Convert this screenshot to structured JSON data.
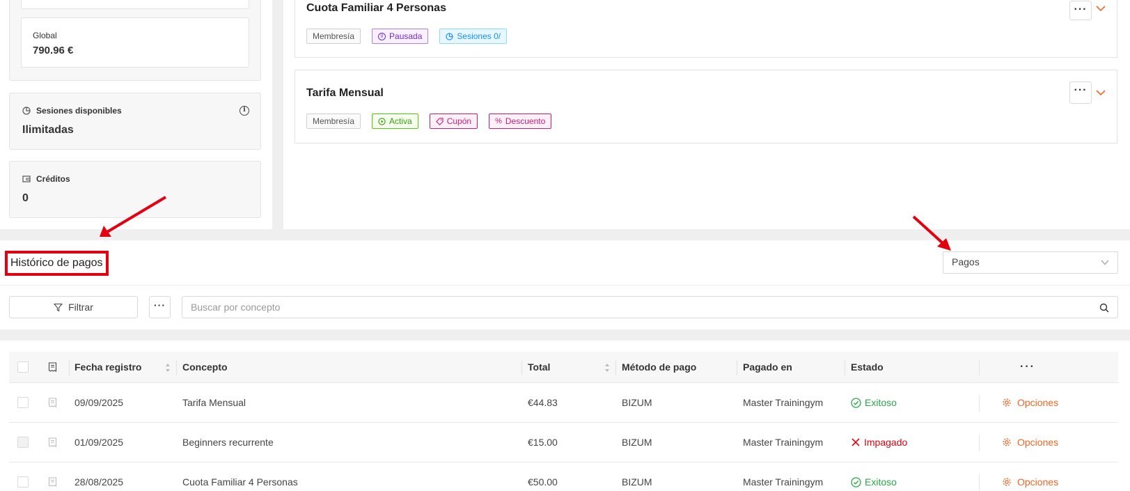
{
  "stats": {
    "global_label": "Global",
    "global_value": "790.96 €",
    "sessions_label": "Sesiones disponibles",
    "sessions_value": "Ilimitadas",
    "credits_label": "Créditos",
    "credits_value": "0"
  },
  "memberships": [
    {
      "title": "Cuota Familiar 4 Personas",
      "tags": [
        "Membresía",
        "Pausada",
        "Sesiones 0/"
      ]
    },
    {
      "title": "Tarifa Mensual",
      "tags": [
        "Membresía",
        "Activa",
        "Cupón",
        "Descuento"
      ]
    }
  ],
  "history": {
    "title": "Histórico de pagos",
    "select_value": "Pagos",
    "filter_label": "Filtrar",
    "search_placeholder": "Buscar por concepto"
  },
  "table": {
    "columns": [
      "Fecha registro",
      "Concepto",
      "Total",
      "Método de pago",
      "Pagado en",
      "Estado"
    ],
    "rows": [
      {
        "date": "09/09/2025",
        "concept": "Tarifa Mensual",
        "total": "€44.83",
        "method": "BIZUM",
        "paid_at": "Master Trainingym",
        "status": "Exitoso",
        "action": "Opciones"
      },
      {
        "date": "01/09/2025",
        "concept": "Beginners recurrente",
        "total": "€15.00",
        "method": "BIZUM",
        "paid_at": "Master Trainingym",
        "status": "Impagado",
        "action": "Opciones"
      },
      {
        "date": "28/08/2025",
        "concept": "Cuota Familiar 4 Personas",
        "total": "€50.00",
        "method": "BIZUM",
        "paid_at": "Master Trainingym",
        "status": "Exitoso",
        "action": "Opciones"
      }
    ]
  },
  "colors": {
    "accent": "#f26522",
    "success": "#27a844",
    "danger": "#e3000f",
    "annotation": "#e3000f"
  },
  "icons": [
    "pie-icon",
    "wallet-icon",
    "info-icon",
    "pause-icon",
    "play-icon",
    "coupon-icon",
    "percent-icon",
    "more-icon",
    "chevron-down-icon",
    "filter-icon",
    "search-icon",
    "receipt-icon",
    "sort-icon",
    "check-circle-icon",
    "x-icon",
    "gear-icon"
  ]
}
